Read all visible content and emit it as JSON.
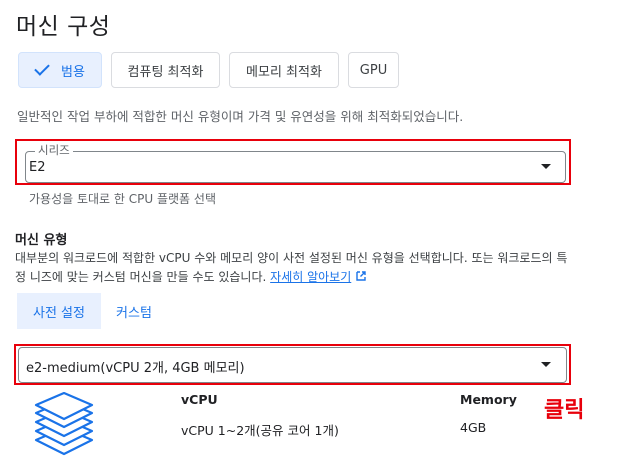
{
  "page": {
    "title": "머신 구성"
  },
  "families": [
    {
      "label": "범용",
      "selected": true
    },
    {
      "label": "컴퓨팅 최적화",
      "selected": false
    },
    {
      "label": "메모리 최적화",
      "selected": false
    },
    {
      "label": "GPU",
      "selected": false
    }
  ],
  "family_description": "일반적인 작업 부하에 적합한 머신 유형이며 가격 및 유연성을 위해 최적화되었습니다.",
  "series": {
    "label": "시리즈",
    "value": "E2",
    "helper": "가용성을 토대로 한 CPU 플랫폼 선택"
  },
  "machine_type": {
    "title": "머신 유형",
    "description": "대부분의 워크로드에 적합한 vCPU 수와 메모리 양이 사전 설정된 머신 유형을 선택합니다. 또는 워크로드의 특정 니즈에 맞는 커스텀 머신을 만들 수도 있습니다.",
    "learn_more": "자세히 알아보기",
    "tabs": [
      {
        "label": "사전 설정",
        "active": true
      },
      {
        "label": "커스텀",
        "active": false
      }
    ],
    "selected": "e2-medium(vCPU 2개, 4GB 메모리)"
  },
  "specs": {
    "vcpu_header": "vCPU",
    "vcpu_value": "vCPU 1~2개(공유 코어 1개)",
    "memory_header": "Memory",
    "memory_value": "4GB"
  },
  "annotation": {
    "text": "클릭",
    "color": "#e8000b"
  },
  "icons": {
    "machine_icon": "layered-stack-icon",
    "external_link": "open-in-new-icon",
    "dropdown": "caret-down-icon",
    "check": "check-icon"
  },
  "colors": {
    "accent": "#1a73e8",
    "selected_bg": "#e8f0fe",
    "highlight": "#e8000b"
  }
}
